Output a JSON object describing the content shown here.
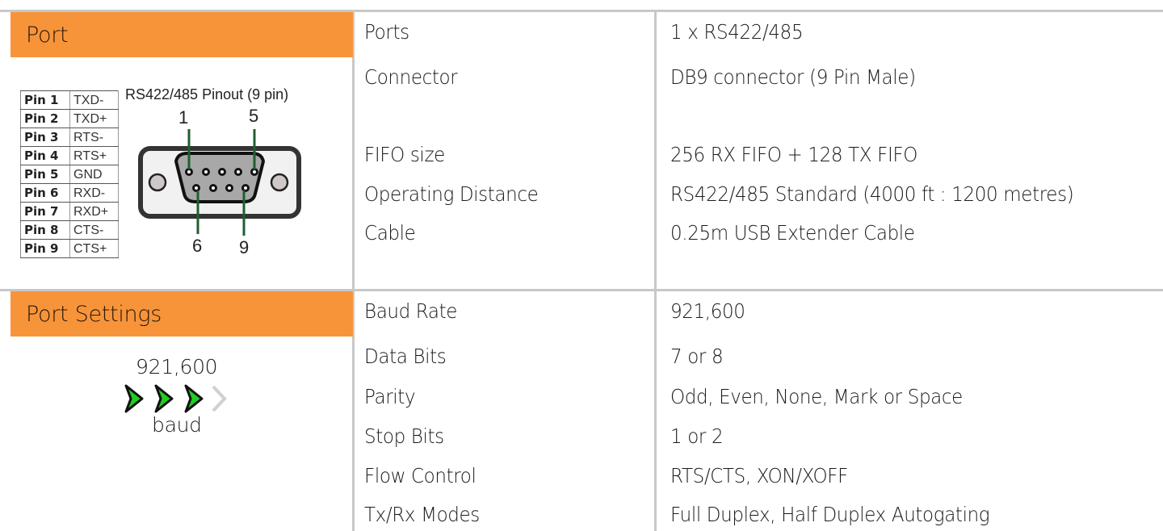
{
  "sections": [
    {
      "title": "Port",
      "rows": [
        {
          "label": "Ports",
          "value": "1 x RS422/485"
        },
        {
          "label": "Connector",
          "value": "DB9 connector (9 Pin Male)"
        },
        {
          "label": "FIFO size",
          "value": "256 RX FIFO + 128 TX FIFO"
        },
        {
          "label": "Operating Distance",
          "value": "RS422/485 Standard (4000 ft : 1200 metres)"
        },
        {
          "label": "Cable",
          "value": "0.25m USB Extender Cable"
        }
      ],
      "pinout": {
        "title": "RS422/485 Pinout (9 pin)",
        "pins": [
          {
            "pin": "Pin 1",
            "signal": "TXD-"
          },
          {
            "pin": "Pin 2",
            "signal": "TXD+"
          },
          {
            "pin": "Pin 3",
            "signal": "RTS-"
          },
          {
            "pin": "Pin 4",
            "signal": "RTS+"
          },
          {
            "pin": "Pin 5",
            "signal": "GND"
          },
          {
            "pin": "Pin 6",
            "signal": "RXD-"
          },
          {
            "pin": "Pin 7",
            "signal": "RXD+"
          },
          {
            "pin": "Pin 8",
            "signal": "CTS-"
          },
          {
            "pin": "Pin 9",
            "signal": "CTS+"
          }
        ],
        "connector_labels": {
          "top_left": "1",
          "top_right": "5",
          "bottom_left": "6",
          "bottom_right": "9"
        }
      }
    },
    {
      "title": "Port Settings",
      "rows": [
        {
          "label": "Baud Rate",
          "value": "921,600"
        },
        {
          "label": "Data Bits",
          "value": "7 or 8"
        },
        {
          "label": "Parity",
          "value": "Odd, Even, None, Mark or Space"
        },
        {
          "label": "Stop Bits",
          "value": "1 or 2"
        },
        {
          "label": "Flow Control",
          "value": "RTS/CTS, XON/XOFF"
        },
        {
          "label": "Tx/Rx Modes",
          "value": "Full Duplex, Half Duplex Autogating"
        }
      ],
      "speed_badge": {
        "value": "921,600",
        "unit": "baud",
        "level": 3,
        "max_level": 4,
        "active_color": "#22cc22",
        "inactive_color": "#d0d0d0"
      }
    }
  ],
  "colors": {
    "header_bg": "#f7943a",
    "divider": "#c8c8c8",
    "pin_wire": "#1f5e32"
  }
}
